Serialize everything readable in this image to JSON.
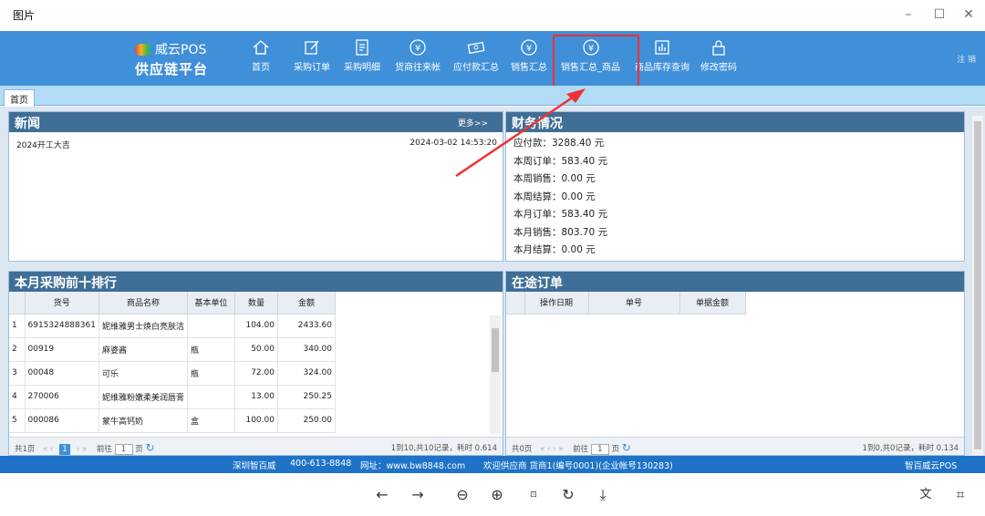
{
  "window": {
    "title": "图片"
  },
  "logo": {
    "line1": "威云POS",
    "line2": "供应链平台"
  },
  "nav": [
    "首页",
    "采购订单",
    "采购明细",
    "货商往来帐",
    "应付款汇总",
    "销售汇总",
    "销售汇总_商品",
    "商品库存查询",
    "修改密码"
  ],
  "header_right": "注 销",
  "tab": "首页",
  "news": {
    "title": "新闻",
    "more": "更多>>",
    "items": [
      {
        "text": "2024开工大吉",
        "date": "2024-03-02 14:53:20"
      }
    ]
  },
  "finance": {
    "title": "财务情况",
    "lines": [
      "应付款：3288.40  元",
      "本周订单：583.40  元",
      "本周销售：0.00  元",
      "本周结算：0.00  元",
      "本月订单：583.40  元",
      "本月销售：803.70  元",
      "本月结算：0.00  元"
    ]
  },
  "top10": {
    "title": "本月采购前十排行",
    "headers": [
      "",
      "货号",
      "商品名称",
      "基本单位",
      "数量",
      "金额"
    ],
    "rows": [
      [
        "1",
        "6915324888361",
        "妮维雅男士焕白亮肤洁",
        "",
        "104.00",
        "2433.60"
      ],
      [
        "2",
        "00919",
        "麻婆酱",
        "瓶",
        "50.00",
        "340.00"
      ],
      [
        "3",
        "00048",
        "可乐",
        "瓶",
        "72.00",
        "324.00"
      ],
      [
        "4",
        "270006",
        "妮维雅粉嫩柔美润唇膏",
        "",
        "13.00",
        "250.25"
      ],
      [
        "5",
        "000086",
        "蒙牛高钙奶",
        "盒",
        "100.00",
        "250.00"
      ]
    ],
    "pager": {
      "total": "共1页",
      "page": "1",
      "goto": "前往",
      "unit": "页",
      "info": "1到10,共10记录，耗时 0.614"
    }
  },
  "transit": {
    "title": "在途订单",
    "headers": [
      "",
      "操作日期",
      "单号",
      "单据金额"
    ],
    "pager": {
      "total": "共0页",
      "goto": "前往",
      "page": "1",
      "unit": "页",
      "info": "1到0,共0记录，耗时 0.134"
    }
  },
  "footer": {
    "company": "深圳智百威",
    "phone": "400-613-8848",
    "site": "网址：www.bw8848.com",
    "welcome": "欢迎供应商  货商1(编号0001)(企业帐号130283)",
    "brand": "智百威云POS"
  }
}
